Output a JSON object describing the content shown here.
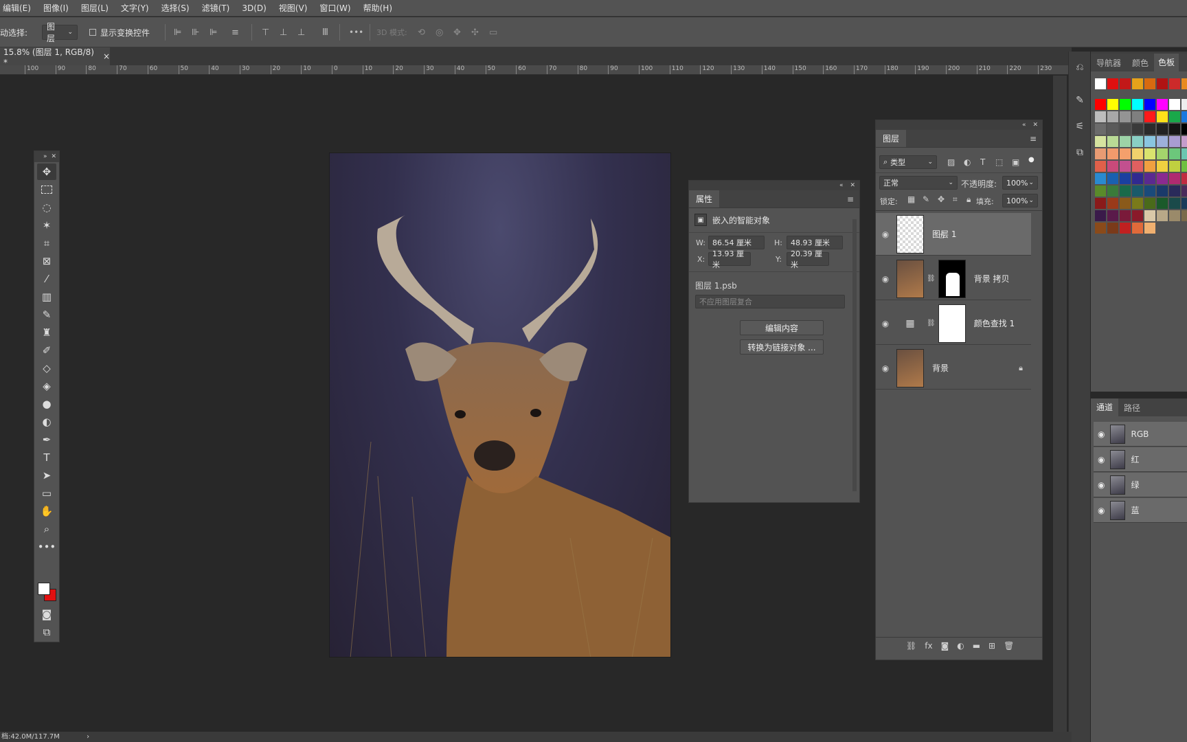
{
  "menu": [
    "编辑(E)",
    "图像(I)",
    "图层(L)",
    "文字(Y)",
    "选择(S)",
    "滤镜(T)",
    "3D(D)",
    "视图(V)",
    "窗口(W)",
    "帮助(H)"
  ],
  "options": {
    "auto_select_label": "动选择:",
    "auto_select_value": "图层",
    "transform_controls_label": "显示变换控件",
    "more_label": "•••",
    "mode_3d_label": "3D 模式:"
  },
  "document_tab": {
    "title": "15.8% (图层 1, RGB/8) *",
    "close": "×"
  },
  "ruler_ticks": [
    "100",
    "90",
    "80",
    "70",
    "60",
    "50",
    "40",
    "30",
    "20",
    "10",
    "0",
    "10",
    "20",
    "30",
    "40",
    "50",
    "60",
    "70",
    "80",
    "90",
    "100",
    "110",
    "120",
    "130",
    "140",
    "150",
    "160",
    "170",
    "180",
    "190",
    "200",
    "210",
    "220",
    "230"
  ],
  "properties_panel": {
    "tab": "属性",
    "type_label": "嵌入的智能对象",
    "w_label": "W:",
    "w_value": "86.54 厘米",
    "h_label": "H:",
    "h_value": "48.93 厘米",
    "x_label": "X:",
    "x_value": "13.93 厘米",
    "y_label": "Y:",
    "y_value": "20.39 厘米",
    "file_name": "图层 1.psb",
    "comp_placeholder": "不应用图层复合",
    "edit_button": "编辑内容",
    "convert_button": "转换为链接对象 ..."
  },
  "layers_panel": {
    "tab": "图层",
    "filter_label": "类型",
    "blend_mode": "正常",
    "opacity_label": "不透明度:",
    "opacity_value": "100%",
    "lock_label": "锁定:",
    "fill_label": "填充:",
    "fill_value": "100%",
    "layers": [
      {
        "name": "图层 1",
        "selected": true
      },
      {
        "name": "背景 拷贝",
        "selected": false
      },
      {
        "name": "颜色查找 1",
        "selected": false
      },
      {
        "name": "背景",
        "selected": false
      }
    ]
  },
  "right_tabs": [
    "导航器",
    "颜色",
    "色板"
  ],
  "channels_panel": {
    "tabs": [
      "通道",
      "路径"
    ],
    "channels": [
      "RGB",
      "红",
      "绿",
      "蓝"
    ]
  },
  "status_bar": {
    "text": "档:42.0M/117.7M",
    "arrow": "›"
  },
  "swatch_colors": {
    "row0": [
      "#ffffff",
      "#e01010",
      "#c21818",
      "#e6a21a",
      "#d86a10",
      "#b01313",
      "#cc2a2a",
      "#e88a20"
    ],
    "rows": [
      [
        "#ff0000",
        "#ffff00",
        "#00ff00",
        "#00ffff",
        "#0000ff",
        "#ff00ff",
        "#ffffff",
        "#eeeeee"
      ],
      [
        "#bdbdbd",
        "#a8a8a8",
        "#949494",
        "#7f7f7f",
        "#ff1a1a",
        "#ffe11a",
        "#19a84a",
        "#1a78e0"
      ],
      [
        "#6b6b6b",
        "#5a5a5a",
        "#4a4a4a",
        "#3a3a3a",
        "#2b2b2b",
        "#222222",
        "#151515",
        "#000000"
      ],
      [
        "#d6e3a0",
        "#b9da95",
        "#9dd3a7",
        "#89cfc4",
        "#8ac6e0",
        "#9db0da",
        "#a99cd1",
        "#c69ccb"
      ],
      [
        "#e89b73",
        "#f19a6c",
        "#f4a06c",
        "#f1d16c",
        "#d9e36e",
        "#a4d46c",
        "#6cc77b",
        "#6cc6b0"
      ],
      [
        "#e0604a",
        "#c94a7a",
        "#c2508f",
        "#e06060",
        "#f0a040",
        "#f0d040",
        "#c0d040",
        "#70c040"
      ],
      [
        "#2a8ad0",
        "#1a60b0",
        "#1a40a0",
        "#302a90",
        "#5a2a90",
        "#8a2a90",
        "#b02a70",
        "#c02a40"
      ],
      [
        "#5a8a2a",
        "#3a7a3a",
        "#1a6a4a",
        "#1a5a6a",
        "#1a4a7a",
        "#1a3a6a",
        "#2a2a5a",
        "#4a2a5a"
      ],
      [
        "#8a1a1a",
        "#9a3a1a",
        "#8a5a1a",
        "#7a7a1a",
        "#4a6a1a",
        "#1a5a2a",
        "#1a4a4a",
        "#1a3a5a"
      ],
      [
        "#3a1a4a",
        "#5a1a4a",
        "#7a1a3a",
        "#8a1a2a",
        "#d9c8a8",
        "#b8a888",
        "#9a8a6a",
        "#7a6a4a"
      ],
      [
        "#8a4a1a",
        "#7a3a1a",
        "#c02020",
        "#e06a3a",
        "#f0b070"
      ]
    ]
  }
}
